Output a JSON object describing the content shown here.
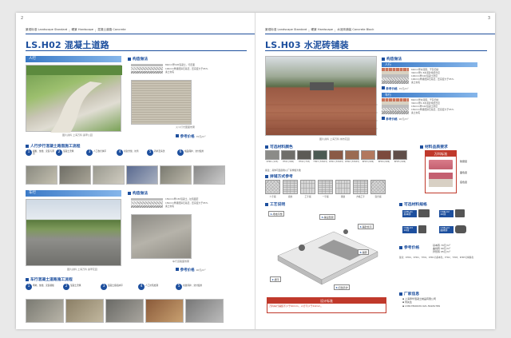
{
  "left": {
    "page_number": "2",
    "breadcrumb": [
      "景观标准 Landscape Standard",
      "硬景 Hardscape",
      "混凝土道路 Concrete"
    ],
    "title": "LS.H02 混凝土道路",
    "sidewalk": {
      "ribbon": "人行",
      "structure_heading": "构造做法",
      "layers": [
        "80mm厚C20混凝土，行走面",
        "100mm厚级配碎石基层，压实度大于95%",
        "素土夯实"
      ],
      "photo_caption_left": "图片资料 上海万科 翡翠公园",
      "photo_caption_right": "火斗灯光图面效果",
      "price_label": "参考价格",
      "price_value": "70元/m²",
      "process_heading": "人行步行混凝土路面施工流程",
      "steps": [
        "模板、放线、安装与调直",
        "混凝土浇筑",
        "人工收光抹平",
        "切割分缝、拉条",
        "养护及清洗",
        "成品保护、交付使用"
      ]
    },
    "driveway": {
      "ribbon": "车行",
      "structure_heading": "构造做法",
      "layers": [
        "150mm厚C30混凝土，拉毛面层",
        "150mm厚级配碎石基层，压实度大于95%",
        "素土夯实"
      ],
      "photo_caption_left": "图片资料 上海万科 翡翠花园",
      "photo_caption_right": "车行道路面效果",
      "price_label": "参考价格",
      "price_value": "90元/m²",
      "process_heading": "车行混凝土道路施工流程",
      "steps": [
        "场地、放线、安装模板",
        "混凝土浇筑",
        "混凝土振捣抹平",
        "人工拉毛处理",
        "切缝养护、交付使用"
      ]
    }
  },
  "right": {
    "page_number": "3",
    "breadcrumb": [
      "景观标准 Landscape Standard",
      "硬景 Hardscape",
      "水泥砖铺装 Concrete Block"
    ],
    "title": "LS.H03 水泥砖铺装",
    "structure_heading": "构造做法",
    "ribbon_walk": "人行",
    "ribbon_drive": "车行",
    "walk_layers": [
      "60mm厚水泥砖，干灰扫缝",
      "30mm厚1:3水泥砂浆结合层",
      "100mm厚C20混凝土垫层",
      "100mm厚级配碎石基层，压实度大于95%",
      "素土夯实"
    ],
    "walk_price": "70元/m²",
    "drive_layers": [
      "80mm厚水泥砖，干灰扫缝",
      "30mm厚1:3水泥砂浆结合层",
      "150mm厚C20混凝土垫层",
      "150mm厚级配碎石基层，压实度大于95%",
      "素土夯实"
    ],
    "drive_price": "90元/m²",
    "price_label": "参考价格",
    "colors_heading": "可选材料颜色",
    "colors": [
      {
        "code": "DH01 (1X3)",
        "hex": "#8b8b88"
      },
      {
        "code": "YH01 (9X6)",
        "hex": "#6f6e6a"
      },
      {
        "code": "YH02 (7X3)",
        "hex": "#5c5a55"
      },
      {
        "code": "YH03 (7X6X3)",
        "hex": "#4b5a53"
      },
      {
        "code": "RH01 (7X6X3)",
        "hex": "#8a5a46"
      },
      {
        "code": "RH02 (7X6X3)",
        "hex": "#9a6b52"
      },
      {
        "code": "RH03 (9X6)",
        "hex": "#b2785e"
      },
      {
        "code": "RH04 (9X6)",
        "hex": "#7b4a3e"
      },
      {
        "code": "RH05 (9X6)",
        "hex": "#5f4e49"
      }
    ],
    "colors_note": "备注：具体可选颜色以厂家样板为准",
    "patterns_heading": "拼铺方式参考",
    "patterns": [
      "人字铺",
      "席纹",
      "工字铺",
      "一字铺",
      "错缝",
      "方格工字",
      "混合铺"
    ],
    "material_req_heading": "材料品质要求",
    "std_head": "万科标准",
    "std_labels": [
      "耐磨层",
      "面色层",
      "底色层"
    ],
    "process_heading": "工艺说明",
    "process_steps": [
      "场地平整",
      "铺设垫层",
      "铺砂找平",
      "铺砖",
      "振平",
      "扫缝养护"
    ],
    "spec_heading": "可选材料规格",
    "specs": [
      "CDB-01 基本砖",
      "CDB-02 20砖",
      "CDB-03 10砖",
      "CDB-04 曲线砖"
    ],
    "ref_price_heading": "参考价格",
    "ref_prices": [
      "基本砖 70元/m²",
      "曲线砖 90元/m²",
      "异形砖 95元/m²"
    ],
    "spec_note": "备注：DH01、DH01、YH01、RH01为基本色，YH02、YH03、RH05为特殊色",
    "design_head": "设计标准",
    "design_text": "万科车行铺装不少于60mm，人行不少于40mm。",
    "maker_heading": "厂家信息",
    "maker_lines": [
      "上海申华混凝土制品有限公司",
      "刘先生",
      "13817800939  021-56181789"
    ]
  }
}
